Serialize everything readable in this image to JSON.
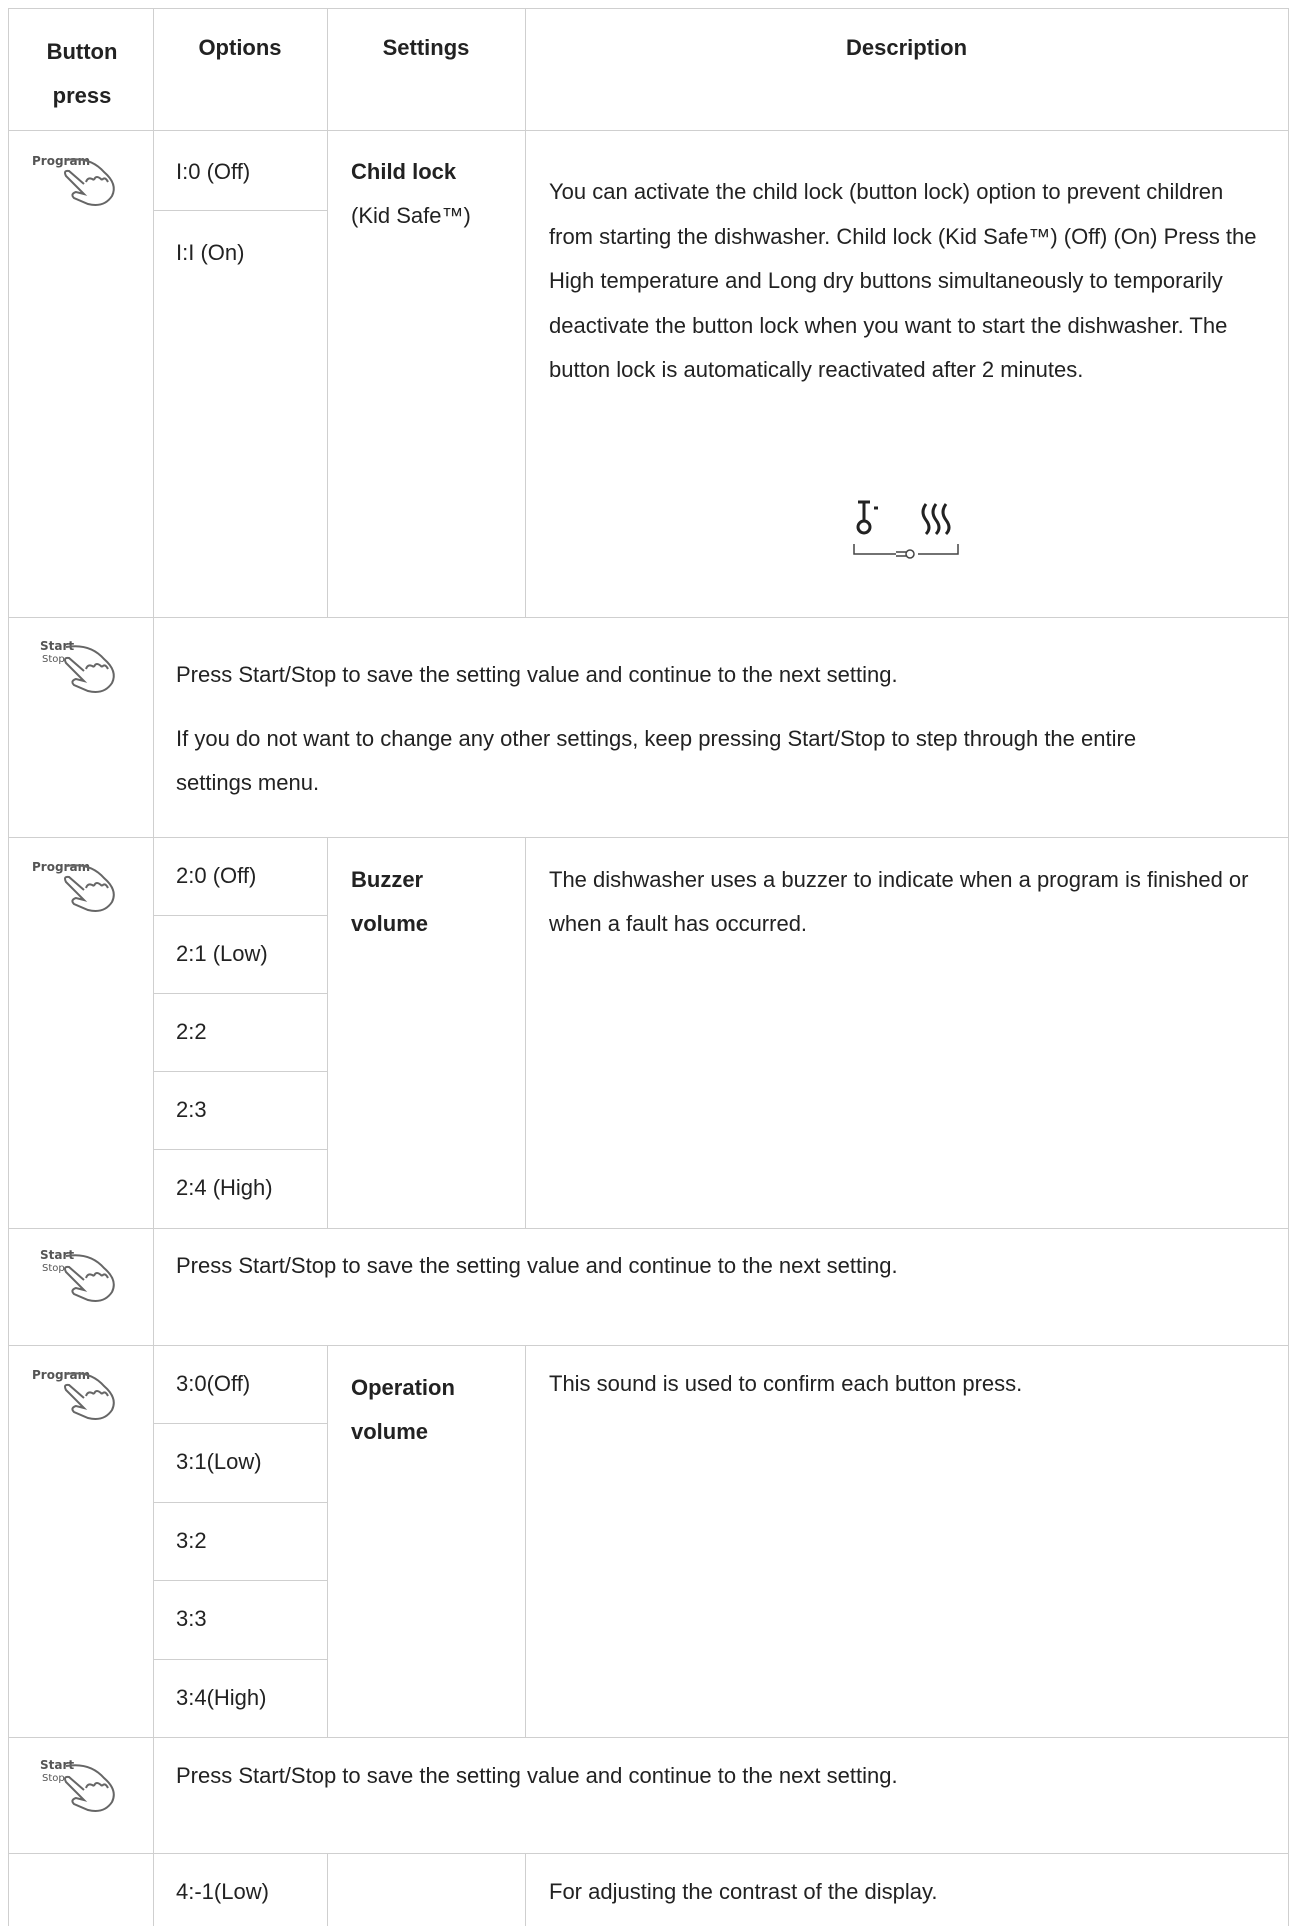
{
  "headers": {
    "button_press": "Button press",
    "options": "Options",
    "settings": "Settings",
    "description": "Description"
  },
  "icons": {
    "program": "Program",
    "start": "Start",
    "stop": "Stop"
  },
  "rows": {
    "child_lock": {
      "options": [
        "I:0 (Off)",
        "I:I (On)"
      ],
      "setting_title": "Child lock",
      "setting_sub": "(Kid Safe™)",
      "description": "You can activate the child lock (button lock) option to prevent children from starting the dishwasher. Child lock (Kid Safe™) (Off) (On) Press the High temperature and Long dry buttons simultaneously to temporarily deactivate the button lock when you want to start the dishwasher. The button lock is automatically reactivated after 2 minutes."
    },
    "start_stop_1": {
      "text1": "Press Start/Stop to save the setting value and continue to the next setting.",
      "text2": "If you do not want to change any other settings, keep pressing Start/Stop to step through the entire settings menu."
    },
    "buzzer": {
      "options": [
        "2:0 (Off)",
        "2:1 (Low)",
        "2:2",
        "2:3",
        "2:4 (High)"
      ],
      "setting_title": "Buzzer volume",
      "description": "The dishwasher uses a buzzer to indicate when a program is finished or when a fault has occurred."
    },
    "start_stop_2": {
      "text": "Press Start/Stop to save the setting value and continue to the next setting."
    },
    "operation": {
      "options": [
        "3:0(Off)",
        "3:1(Low)",
        "3:2",
        "3:3",
        "3:4(High)"
      ],
      "setting_title": "Operation volume",
      "description": "This sound is used to confirm each button press."
    },
    "start_stop_3": {
      "text": "Press Start/Stop to save the setting value and continue to the next setting."
    },
    "contrast": {
      "options": [
        "4:-1(Low)"
      ],
      "description": "For adjusting the contrast of the display."
    }
  }
}
